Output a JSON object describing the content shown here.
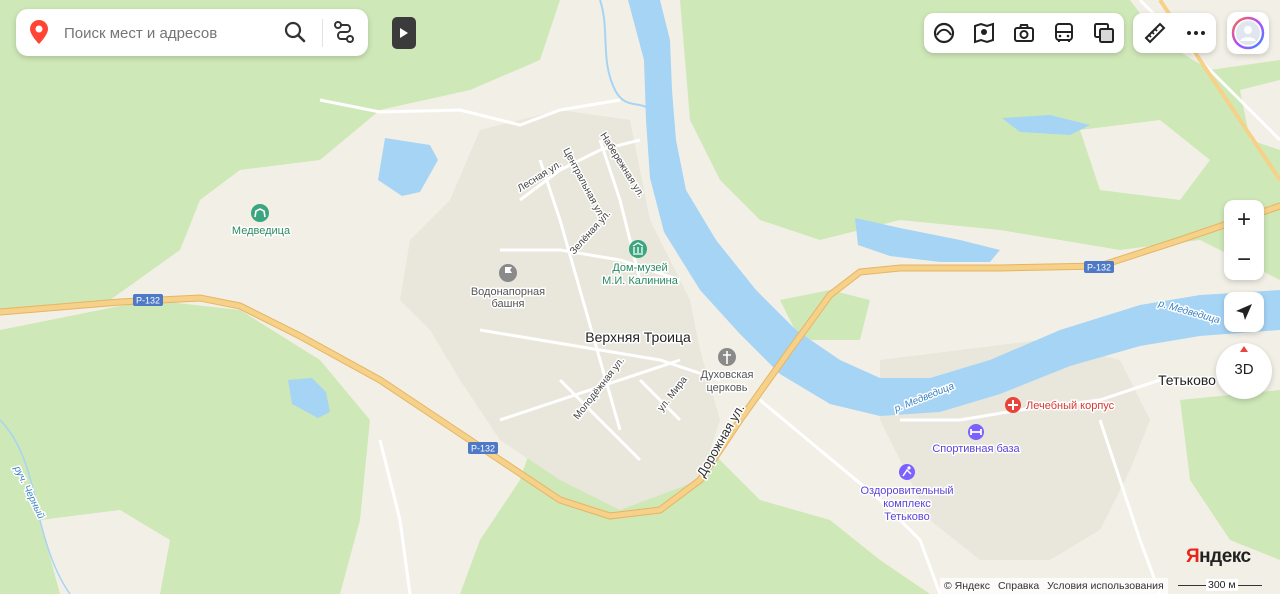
{
  "search": {
    "placeholder": "Поиск мест и адресов",
    "pin_icon": "map-pin-icon",
    "search_icon": "search-icon",
    "route_icon": "route-icon"
  },
  "map": {
    "places": [
      {
        "id": "medveditsa",
        "label": "Медведица",
        "icon": "horse-icon"
      },
      {
        "id": "vodonapornaya",
        "line1": "Водонапорная",
        "line2": "башня",
        "icon": "flag-icon"
      },
      {
        "id": "museum",
        "line1": "Дом-музей",
        "line2": "М.И. Калинина",
        "icon": "museum-icon"
      },
      {
        "id": "town",
        "label": "Верхняя Троица"
      },
      {
        "id": "church",
        "line1": "Духовская",
        "line2": "церковь",
        "icon": "church-icon"
      },
      {
        "id": "tetkovo",
        "label": "Тетьково"
      },
      {
        "id": "hospital",
        "label": "Лечебный корпус",
        "icon": "medical-cross-icon"
      },
      {
        "id": "sport",
        "label": "Спортивная база",
        "icon": "dumbbell-icon"
      },
      {
        "id": "health",
        "line1": "Оздоровительный",
        "line2": "комплекс",
        "line3": "Тетьково",
        "icon": "swimmer-icon"
      }
    ],
    "streets": {
      "lesnaya": "Лесная ул.",
      "centralnaya": "Центральная ул.",
      "naberezhnaya": "Набережная ул.",
      "zelenaya": "Зелёная ул.",
      "molodezhnaya": "Молодёжная ул.",
      "mira": "ул. Мира",
      "dorozhnaya": "Дорожная ул."
    },
    "road_shield": "Р-132",
    "rivers": {
      "medveditsa": "р. Медведица",
      "chernyi": "руч. Черный"
    }
  },
  "controls": {
    "layers": [
      "panorama-icon",
      "map-guide-icon",
      "camera-icon",
      "transit-icon",
      "layers-icon"
    ],
    "tools": [
      "ruler-icon",
      "more-icon"
    ],
    "zoom_in": "+",
    "zoom_out": "−",
    "view_3d": "3D"
  },
  "footer": {
    "copyright": "© Яндекс",
    "help": "Справка",
    "terms": "Условия использования",
    "scale": "300 м"
  },
  "brand": {
    "first": "Я",
    "rest": "ндекс"
  },
  "colors": {
    "forest": "#cfe8b8",
    "field": "#f2f0e6",
    "water": "#a6d4f5",
    "road": "#f6d189",
    "poi_green": "#3aa57e",
    "poi_gray": "#8a8a8a",
    "poi_red": "#e8443a",
    "poi_purple": "#7b61ff",
    "shield": "#4d79c7"
  }
}
